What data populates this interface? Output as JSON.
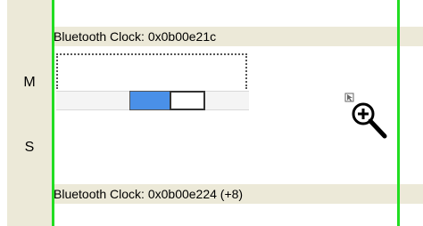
{
  "rows": {
    "master_label": "M",
    "slave_label": "S"
  },
  "clock_top": {
    "text": "Bluetooth Clock: 0x0b00e21c"
  },
  "clock_bottom": {
    "text": "Bluetooth Clock: 0x0b00e224 (+8)"
  },
  "colors": {
    "marker_line": "#22dd22",
    "band": "#ece9d8",
    "active_slot": "#4a90e8"
  },
  "icons": {
    "zoom": "zoom-in-icon"
  }
}
